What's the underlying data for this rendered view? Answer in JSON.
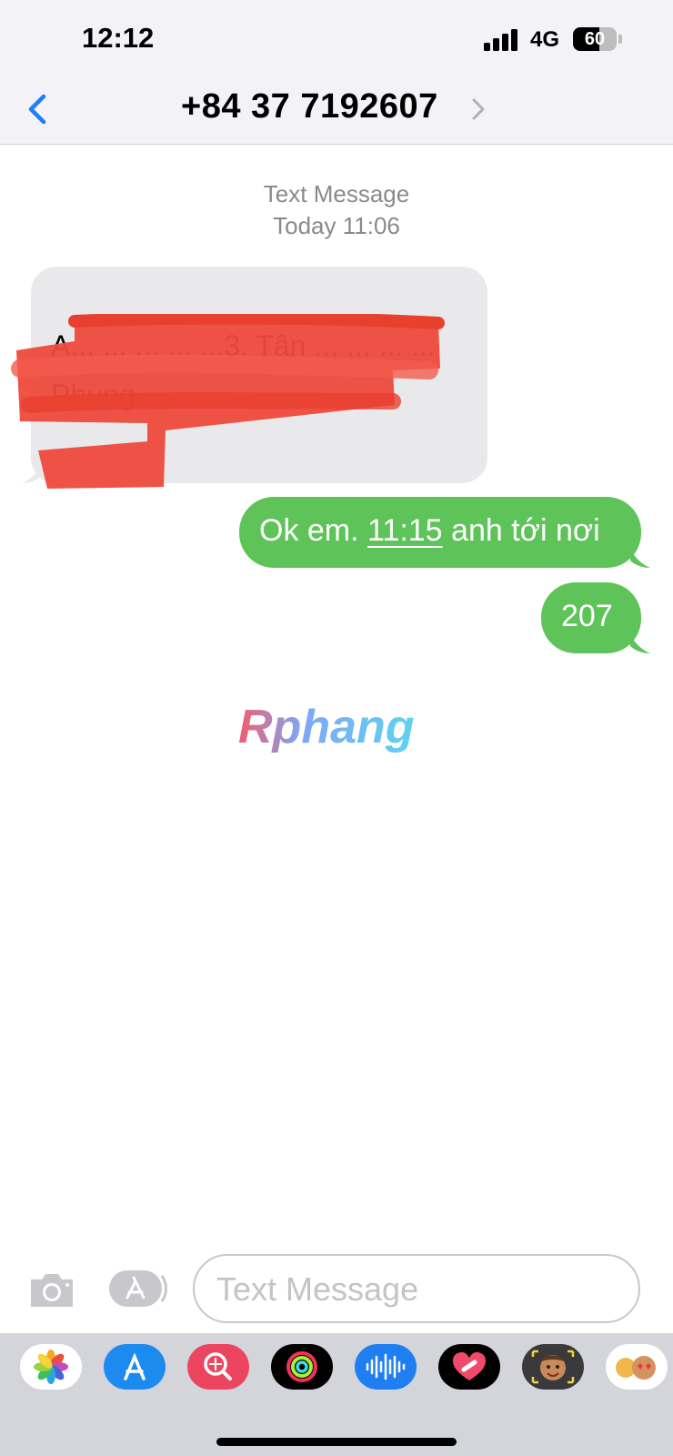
{
  "status_bar": {
    "time": "12:12",
    "network": "4G",
    "battery_level": "60",
    "battery_fraction": 0.6
  },
  "nav": {
    "back_icon": "chevron-left-icon",
    "contact": "+84 37 7192607",
    "details_icon": "chevron-right-icon"
  },
  "conversation": {
    "service": "Text Message",
    "timestamp": "Today 11:06",
    "messages": [
      {
        "direction": "incoming",
        "text": "A... ... ... ... ...3. Tân ... ... ... ... Phụng",
        "redacted": true
      },
      {
        "direction": "outgoing",
        "text_before": "Ok em. ",
        "time_link": "11:15",
        "text_after": " anh tới nơi"
      },
      {
        "direction": "outgoing",
        "text": "207"
      }
    ]
  },
  "watermark": {
    "text": "Rphang"
  },
  "composer": {
    "camera_icon": "camera-icon",
    "apps_icon": "app-store-icon",
    "placeholder": "Text Message"
  },
  "app_drawer": {
    "apps": [
      "photos-icon",
      "app-store-icon",
      "search-images-icon",
      "activity-icon",
      "audio-message-icon",
      "digital-touch-icon",
      "memoji-icon",
      "memoji-stickers-icon"
    ]
  },
  "colors": {
    "accent_blue": "#1d7ff5",
    "imessage_green": "#5ec45a",
    "incoming_gray": "#e9e9eb",
    "redaction_red": "#ee4a3c"
  }
}
